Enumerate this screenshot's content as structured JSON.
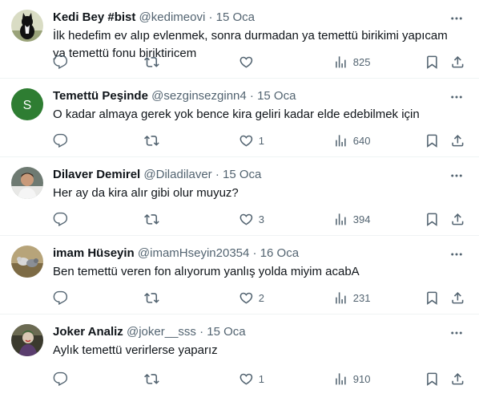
{
  "tweets": [
    {
      "name": "Kedi Bey #bist",
      "handle": "@kedimeovi",
      "dot": "·",
      "time": "15 Oca",
      "text": "İlk hedefim ev alıp evlenmek, sonra durmadan ya temettü birikimi yapıcam ya temettü fonu biriktiricem",
      "likes": "",
      "views": "825",
      "avatar": "cat"
    },
    {
      "name": "Temettü Peşinde",
      "handle": "@sezginsezginn4",
      "dot": "·",
      "time": "15 Oca",
      "text": "O kadar almaya gerek yok bence kira geliri kadar elde edebilmek için",
      "likes": "1",
      "views": "640",
      "avatar": "letter",
      "avatar_letter": "S",
      "avatar_color": "#2e7d32"
    },
    {
      "name": "Dilaver Demirel",
      "handle": "@Diladilaver",
      "dot": "·",
      "time": "15 Oca",
      "text": "Her ay da kira alır gibi olur muyuz?",
      "likes": "3",
      "views": "394",
      "avatar": "photo"
    },
    {
      "name": "imam Hüseyin",
      "handle": "@imamHseyin20354",
      "dot": "·",
      "time": "16 Oca",
      "text": "Ben temettü veren fon alıyorum yanlış yolda miyim acabA",
      "likes": "2",
      "views": "231",
      "avatar": "birds"
    },
    {
      "name": "Joker Analiz",
      "handle": "@joker__sss",
      "dot": "·",
      "time": "15 Oca",
      "text": "Aylık temettü verirlerse yaparız",
      "likes": "1",
      "views": "910",
      "avatar": "joker"
    }
  ],
  "icons": {
    "reply": "reply-icon",
    "retweet": "retweet-icon",
    "like": "like-icon",
    "views": "views-icon",
    "bookmark": "bookmark-icon",
    "share": "share-icon",
    "more": "more-icon"
  },
  "colors": {
    "text": "#0f1419",
    "secondary": "#536471",
    "divider": "#eff3f4"
  }
}
